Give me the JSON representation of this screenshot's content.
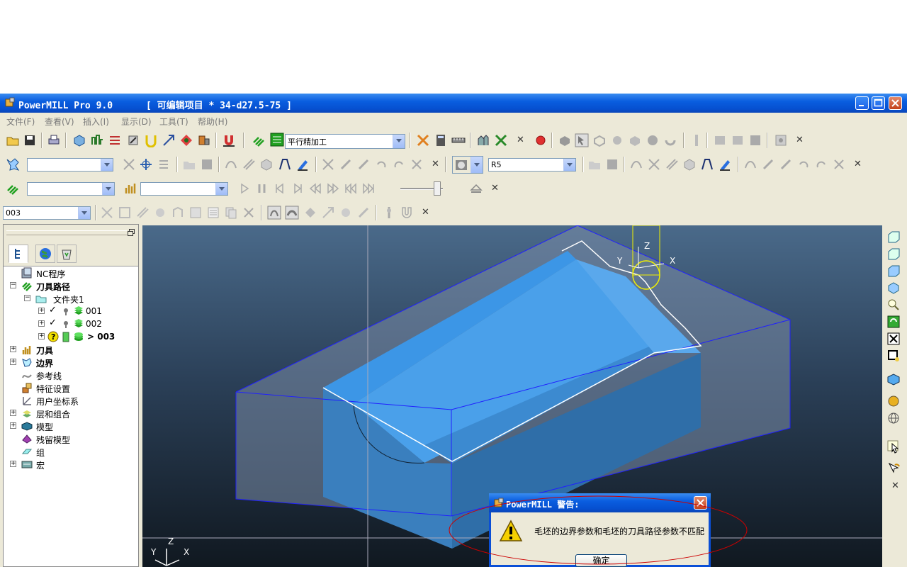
{
  "window": {
    "title": "PowerMILL Pro 9.0      [ 可编辑项目 * 34-d27.5-75 ]"
  },
  "menu": [
    "文件(F)",
    "查看(V)",
    "插入(I)",
    "显示(D)",
    "工具(T)",
    "帮助(H)"
  ],
  "toolbar1": {
    "strategy_combo": "平行精加工"
  },
  "toolbar2": {
    "tool_combo": "R5"
  },
  "toolbar4": {
    "toolpath_combo": "003"
  },
  "explorer": {
    "items": [
      {
        "label": "NC程序",
        "bold": false
      },
      {
        "label": "刀具路径",
        "bold": true
      },
      {
        "label": "文件夹1",
        "bold": false
      },
      {
        "label": "001",
        "bold": false
      },
      {
        "label": "002",
        "bold": false
      },
      {
        "label": "> 003",
        "bold": true
      },
      {
        "label": "刀具",
        "bold": true
      },
      {
        "label": "边界",
        "bold": true
      },
      {
        "label": "参考线",
        "bold": false
      },
      {
        "label": "特征设置",
        "bold": false
      },
      {
        "label": "用户坐标系",
        "bold": false
      },
      {
        "label": "层和组合",
        "bold": false
      },
      {
        "label": "模型",
        "bold": false
      },
      {
        "label": "残留模型",
        "bold": false
      },
      {
        "label": "组",
        "bold": false
      },
      {
        "label": "宏",
        "bold": false
      }
    ]
  },
  "viewport": {
    "axis_labels": {
      "x": "X",
      "y": "Y",
      "z": "Z"
    }
  },
  "dialog": {
    "title": "PowerMILL 警告:",
    "message": "毛坯的边界参数和毛坯的刀具路径参数不匹配",
    "ok_label": "确定"
  },
  "colors": {
    "titlebar": "#0a5ee0",
    "part": "#3c8ad0",
    "block_edge": "#2020ff",
    "highlight_ellipse": "#cc0000"
  }
}
